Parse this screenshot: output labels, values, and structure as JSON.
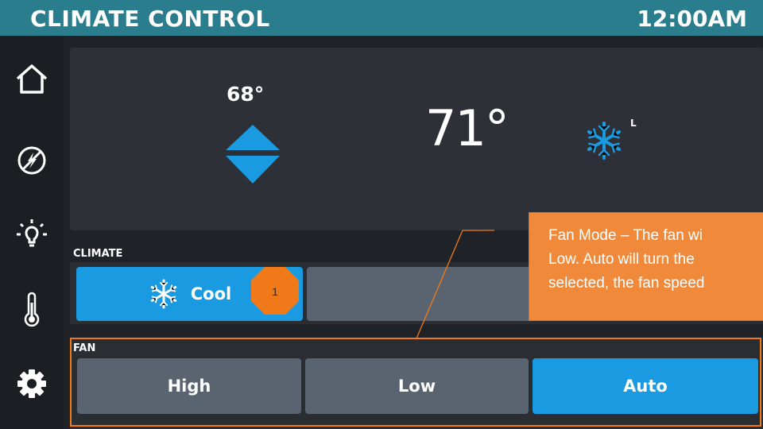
{
  "header": {
    "title": "CLIMATE CONTROL",
    "time": "12:00AM"
  },
  "sidebar": {
    "items": [
      {
        "icon": "home-icon"
      },
      {
        "icon": "power-saver-icon"
      },
      {
        "icon": "light-bulb-icon"
      },
      {
        "icon": "thermometer-icon"
      },
      {
        "icon": "gear-icon"
      }
    ]
  },
  "thermostat": {
    "setpoint": "68°",
    "current_temp": "71°",
    "fan_indicator": "L",
    "mode_icon": "snowflake-icon"
  },
  "climate": {
    "label": "CLIMATE",
    "options": [
      {
        "label": "Cool",
        "icon": "snowflake-icon",
        "selected": true
      },
      {
        "label": "",
        "selected": false
      }
    ]
  },
  "fan": {
    "label": "FAN",
    "options": [
      {
        "label": "High",
        "selected": false
      },
      {
        "label": "Low",
        "selected": false
      },
      {
        "label": "Auto",
        "selected": true
      }
    ]
  },
  "annotation": {
    "badge_number": "1",
    "callout_lines": [
      "Fan Mode – The fan wi",
      "Low.  Auto will turn the",
      "selected, the fan speed"
    ]
  },
  "colors": {
    "header": "#2a7d8c",
    "selected": "#1a9ae0",
    "unselected": "#5a6470",
    "callout": "#f08a3a",
    "highlight": "#f07a1a"
  }
}
